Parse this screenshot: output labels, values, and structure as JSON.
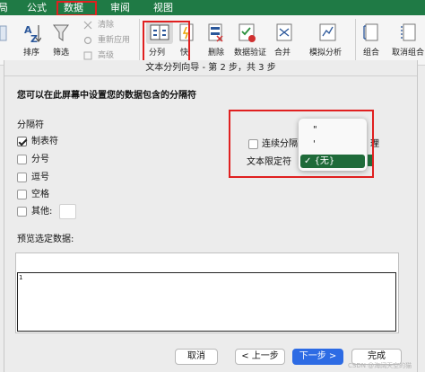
{
  "menubar": {
    "items": [
      {
        "label": "局"
      },
      {
        "label": "公式"
      },
      {
        "label": "数据"
      },
      {
        "label": "审阅"
      },
      {
        "label": "视图"
      }
    ]
  },
  "ribbon": {
    "sort_label": "排序",
    "filter_label": "筛选",
    "clear_label": "清除",
    "reapply_label": "重新应用",
    "advanced_label": "高级",
    "split_label": "分列",
    "quick_label": "快",
    "delete_label": "删除",
    "validation_label": "数据验证",
    "merge_label": "合并",
    "whatif_label": "模拟分析",
    "group_label": "组合",
    "ungroup_label": "取消组合"
  },
  "dialog": {
    "title": "文本分列向导 - 第 2 步，共 3 步",
    "instruction": "您可以在此屏幕中设置您的数据包含的分隔符",
    "delimiters_heading": "分隔符",
    "delimiters": [
      {
        "label": "制表符",
        "checked": true
      },
      {
        "label": "分号",
        "checked": false
      },
      {
        "label": "逗号",
        "checked": false
      },
      {
        "label": "空格",
        "checked": false
      },
      {
        "label": "其他:",
        "checked": false
      }
    ],
    "consecutive_label": "连续分隔",
    "consecutive_suffix": "理",
    "qualifier_label": "文本限定符",
    "preview_heading": "预览选定数据:",
    "preview_row": "1",
    "qualifier_options": [
      {
        "label": "\"",
        "selected": false
      },
      {
        "label": "'",
        "selected": false
      },
      {
        "label": "{无}",
        "selected": true
      }
    ],
    "buttons": {
      "cancel": "取消",
      "prev": "< 上一步",
      "next": "下一步 >",
      "finish": "完成"
    }
  },
  "watermark": "CSDN @海阔天空的猫",
  "colors": {
    "menubar": "#1f7a45",
    "highlight": "#e02020",
    "primary_button": "#2d6be4",
    "selected_option": "#1f6b3a"
  }
}
